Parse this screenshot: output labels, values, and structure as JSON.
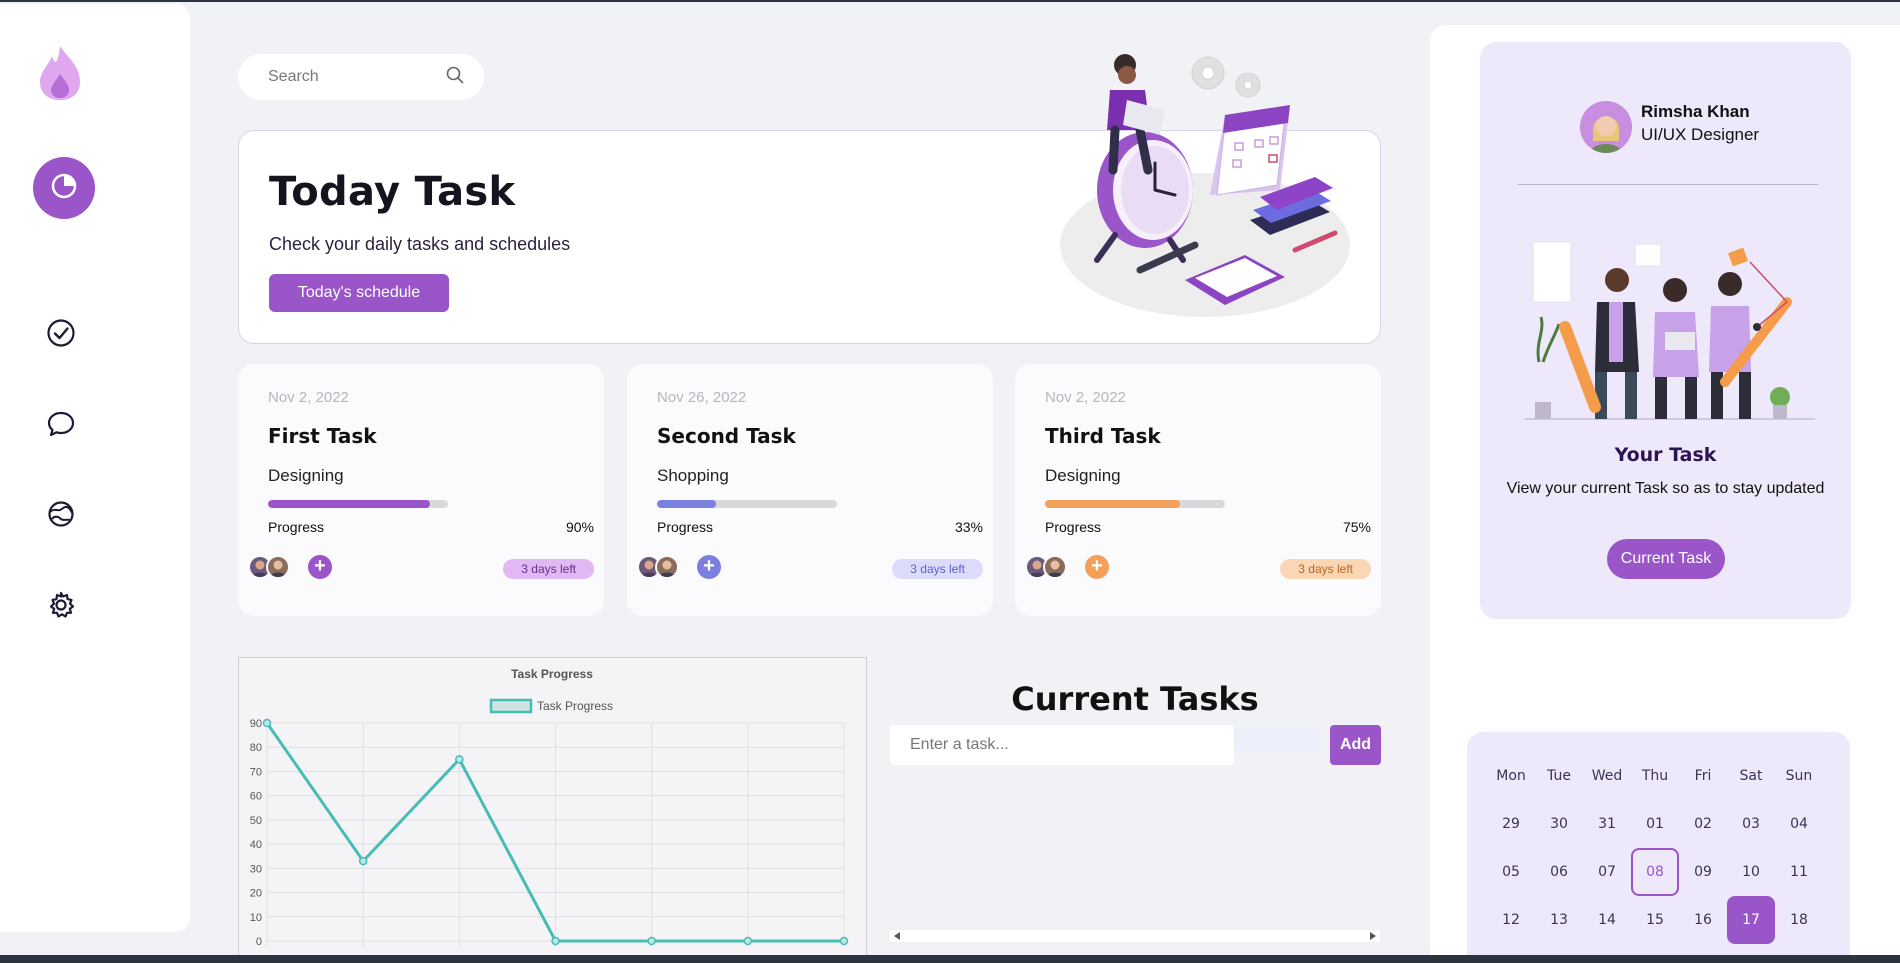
{
  "search": {
    "placeholder": "Search"
  },
  "hero": {
    "title": "Today Task",
    "subtitle": "Check your daily tasks and schedules",
    "button_label": "Today's schedule"
  },
  "tasks": [
    {
      "date": "Nov 2, 2022",
      "title": "First Task",
      "category": "Designing",
      "progress_label": "Progress",
      "progress_value": "90%",
      "progress": 0.9,
      "badge": "3 days left",
      "color": "#9a55c9",
      "badge_bg": "#e0b9f2",
      "badge_fg": "#6a2b90"
    },
    {
      "date": "Nov 26, 2022",
      "title": "Second Task",
      "category": "Shopping",
      "progress_label": "Progress",
      "progress_value": "33%",
      "progress": 0.33,
      "badge": "3 days left",
      "color": "#7b7fe0",
      "badge_bg": "#dcdcfa",
      "badge_fg": "#5d62c8"
    },
    {
      "date": "Nov 2, 2022",
      "title": "Third Task",
      "category": "Designing",
      "progress_label": "Progress",
      "progress_value": "75%",
      "progress": 0.75,
      "badge": "3 days left",
      "color": "#f5a05a",
      "badge_bg": "#fbd6b5",
      "badge_fg": "#c0641c"
    }
  ],
  "chart_data": {
    "type": "line",
    "title": "Task Progress",
    "series": [
      {
        "name": "Task Progress",
        "values": [
          90,
          33,
          75,
          0,
          0,
          0,
          0
        ]
      }
    ],
    "ylim": [
      0,
      90
    ],
    "yticks": [
      0,
      10,
      20,
      30,
      40,
      50,
      60,
      70,
      80,
      90
    ],
    "grid": true,
    "legend": "top-center",
    "color": "#45bcb6"
  },
  "current_tasks": {
    "title": "Current Tasks",
    "input_placeholder": "Enter a task...",
    "add_label": "Add"
  },
  "profile": {
    "name": "Rimsha Khan",
    "role": "UI/UX Designer",
    "card_title": "Your Task",
    "card_subtitle": "View your current Task so as to stay updated",
    "button_label": "Current Task"
  },
  "calendar": {
    "weekdays": [
      "Mon",
      "Tue",
      "Wed",
      "Thu",
      "Fri",
      "Sat",
      "Sun"
    ],
    "weeks": [
      [
        "29",
        "30",
        "31",
        "01",
        "02",
        "03",
        "04"
      ],
      [
        "05",
        "06",
        "07",
        "08",
        "09",
        "10",
        "11"
      ],
      [
        "12",
        "13",
        "14",
        "15",
        "16",
        "17",
        "18"
      ]
    ],
    "today": "08",
    "selected": "17"
  },
  "colors": {
    "accent": "#9a55c9",
    "background": "#f1f2f6"
  }
}
